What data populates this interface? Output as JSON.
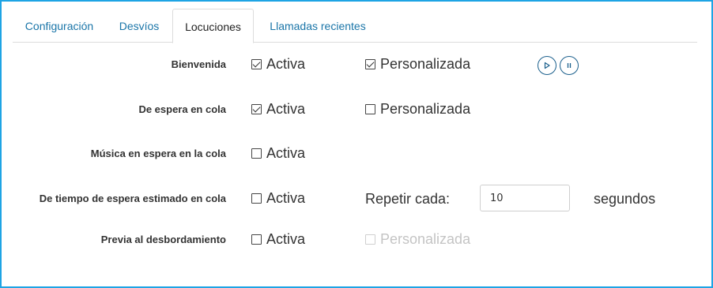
{
  "tabs": [
    {
      "label": "Configuración",
      "active": false
    },
    {
      "label": "Desvíos",
      "active": false
    },
    {
      "label": "Locuciones",
      "active": true
    },
    {
      "label": "Llamadas recientes",
      "active": false
    }
  ],
  "rows": {
    "bienvenida": {
      "label": "Bienvenida",
      "activa": {
        "label": "Activa",
        "checked": true
      },
      "personalizada": {
        "label": "Personalizada",
        "checked": true
      },
      "play_icon": "play-icon",
      "pause_icon": "pause-icon"
    },
    "espera_cola": {
      "label": "De espera en cola",
      "activa": {
        "label": "Activa",
        "checked": true
      },
      "personalizada": {
        "label": "Personalizada",
        "checked": false
      }
    },
    "musica_espera": {
      "label": "Música en espera en la cola",
      "activa": {
        "label": "Activa",
        "checked": false
      }
    },
    "tiempo_estimado": {
      "label": "De tiempo de espera estimado en cola",
      "activa": {
        "label": "Activa",
        "checked": false
      },
      "repeat_label": "Repetir cada:",
      "repeat_value": "10",
      "unit_label": "segundos"
    },
    "previa_desbordamiento": {
      "label": "Previa al desbordamiento",
      "activa": {
        "label": "Activa",
        "checked": false
      },
      "personalizada": {
        "label": "Personalizada",
        "checked": false,
        "disabled": true
      }
    }
  },
  "colors": {
    "frame_border": "#1ea4e4",
    "tab_link": "#1a75a8",
    "disabled_text": "#c4c4c4",
    "icon_button": "#1a5f8c"
  }
}
